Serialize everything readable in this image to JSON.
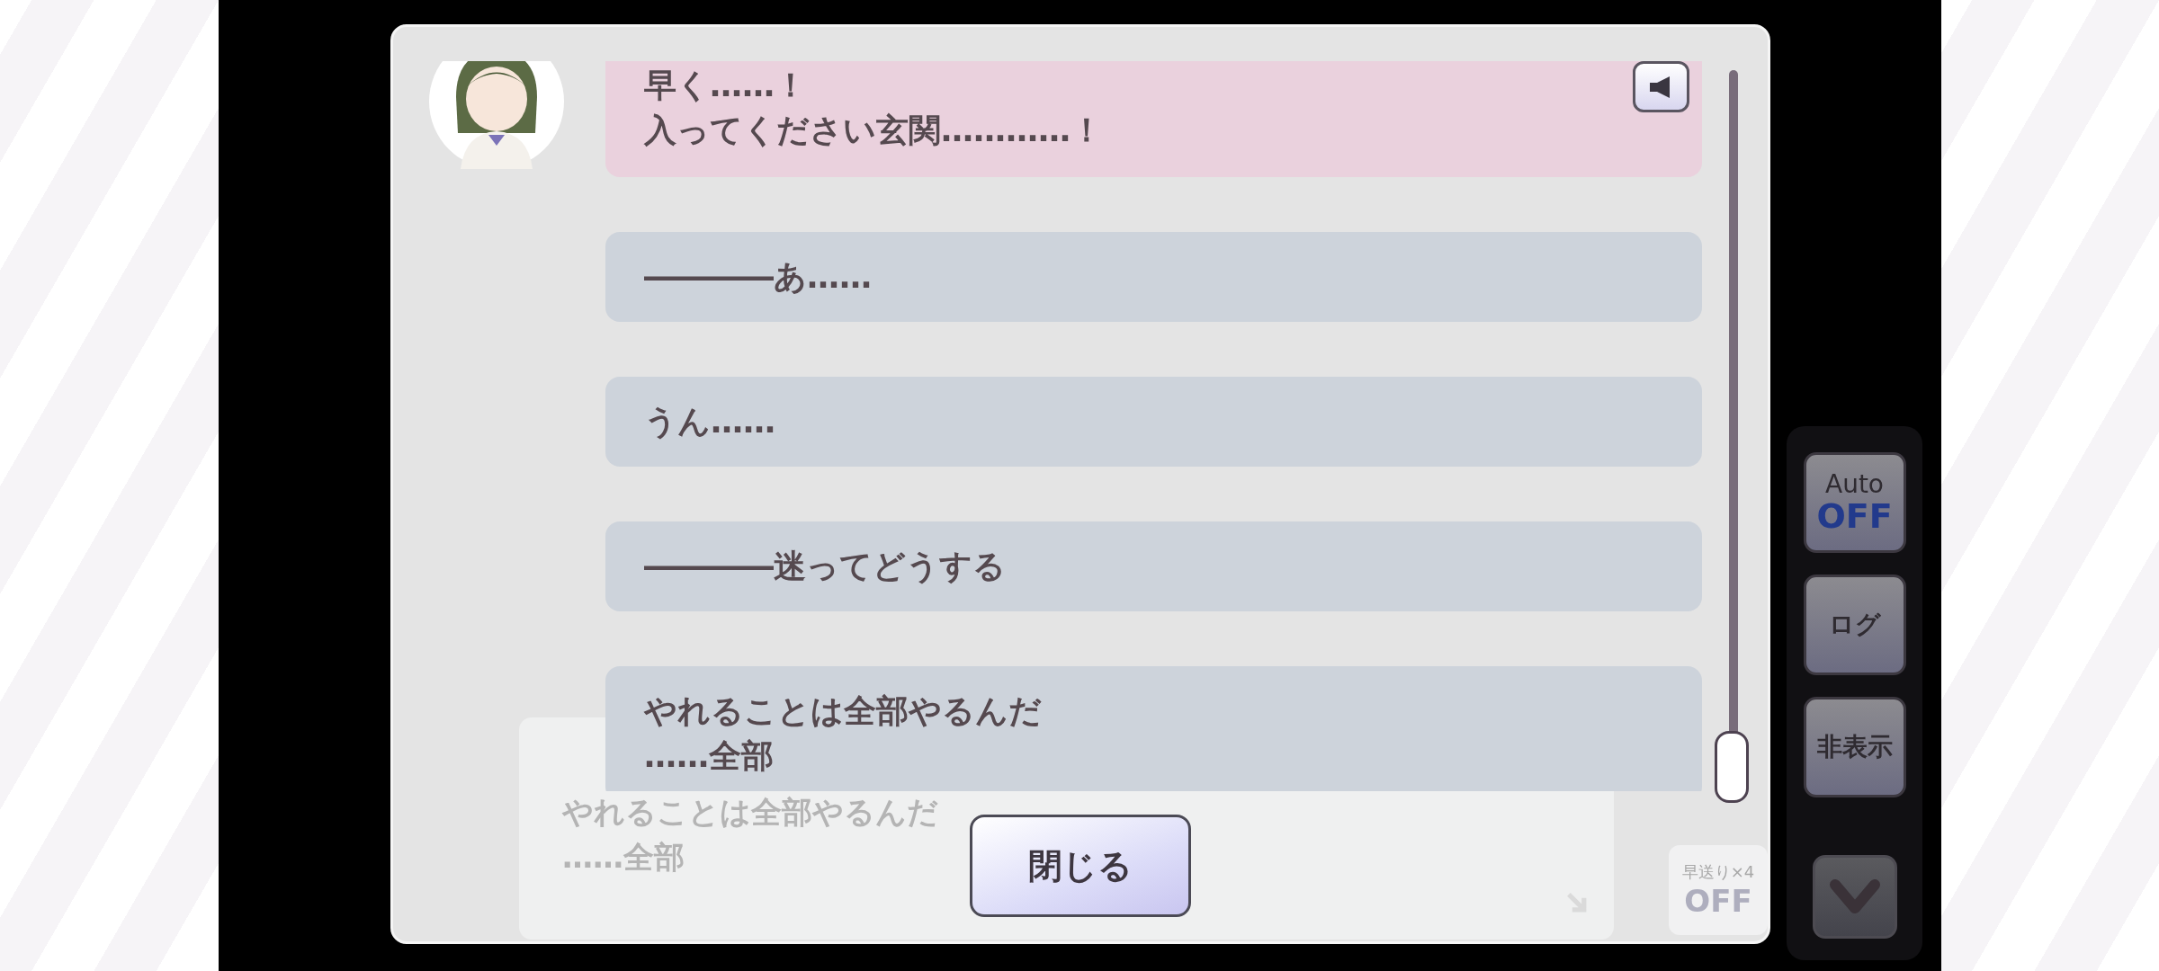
{
  "log": {
    "entries": [
      {
        "kind": "character",
        "lines": [
          "早く……！",
          "入ってください玄関…………！"
        ],
        "voice": true
      },
      {
        "kind": "narration",
        "lines": [
          "――――あ……"
        ]
      },
      {
        "kind": "narration",
        "lines": [
          "うん……"
        ]
      },
      {
        "kind": "narration",
        "lines": [
          "――――迷ってどうする"
        ]
      },
      {
        "kind": "narration",
        "lines": [
          "やれることは全部やるんだ",
          "……全部"
        ]
      }
    ]
  },
  "close_button": "閉じる",
  "background_message": {
    "lines": [
      "やれることは全部やるんだ",
      "……全部"
    ]
  },
  "fast_forward": {
    "label": "早送り×4",
    "state": "OFF"
  },
  "side_buttons": [
    {
      "kind": "auto",
      "label": "Auto",
      "state": "OFF"
    },
    {
      "kind": "text",
      "label": "ログ"
    },
    {
      "kind": "text",
      "label": "非表示"
    },
    {
      "kind": "chevron"
    }
  ]
}
